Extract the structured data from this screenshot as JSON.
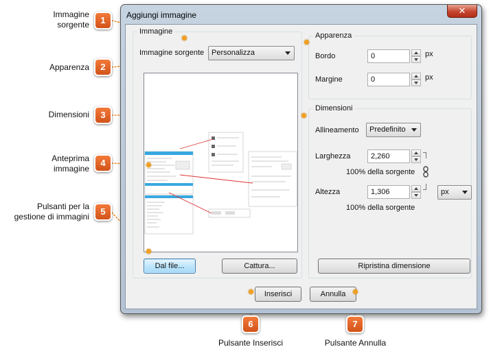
{
  "window": {
    "title": "Aggiungi immagine",
    "close_glyph": "✕"
  },
  "image_group": {
    "title": "Immagine",
    "source_label": "Immagine sorgente",
    "source_value": "Personalizza",
    "from_file_button": "Dal file...",
    "capture_button": "Cattura..."
  },
  "appearance_group": {
    "title": "Apparenza",
    "border_label": "Bordo",
    "border_value": "0",
    "border_unit": "px",
    "margin_label": "Margine",
    "margin_value": "0",
    "margin_unit": "px"
  },
  "dimensions_group": {
    "title": "Dimensioni",
    "alignment_label": "Allineamento",
    "alignment_value": "Predefinito",
    "width_label": "Larghezza",
    "width_value": "2,260",
    "width_percent": "100% della sorgente",
    "height_label": "Altezza",
    "height_value": "1,306",
    "height_percent": "100% della sorgente",
    "unit_value": "px",
    "reset_button": "Ripristina dimensione"
  },
  "footer": {
    "insert_button": "Inserisci",
    "cancel_button": "Annulla"
  },
  "callouts": [
    {
      "number": "1",
      "text": "Immagine\nsorgente"
    },
    {
      "number": "2",
      "text": "Apparenza"
    },
    {
      "number": "3",
      "text": "Dimensioni"
    },
    {
      "number": "4",
      "text": "Anteprima\nimmagine"
    },
    {
      "number": "5",
      "text": "Pulsanti per la\ngestione di immagini"
    },
    {
      "number": "6",
      "text": "Pulsante Inserisci"
    },
    {
      "number": "7",
      "text": "Pulsante Annulla"
    }
  ],
  "colors": {
    "callout_badge": "#e0632a",
    "callout_line": "#f08a1c",
    "window_frame": "#b9c8d8",
    "focus_button": "#bee6fd"
  },
  "icons": {
    "close": "close-icon",
    "dropdown": "chevron-down-icon",
    "spin": "spin-arrows-icon",
    "link": "chain-link-icon"
  }
}
